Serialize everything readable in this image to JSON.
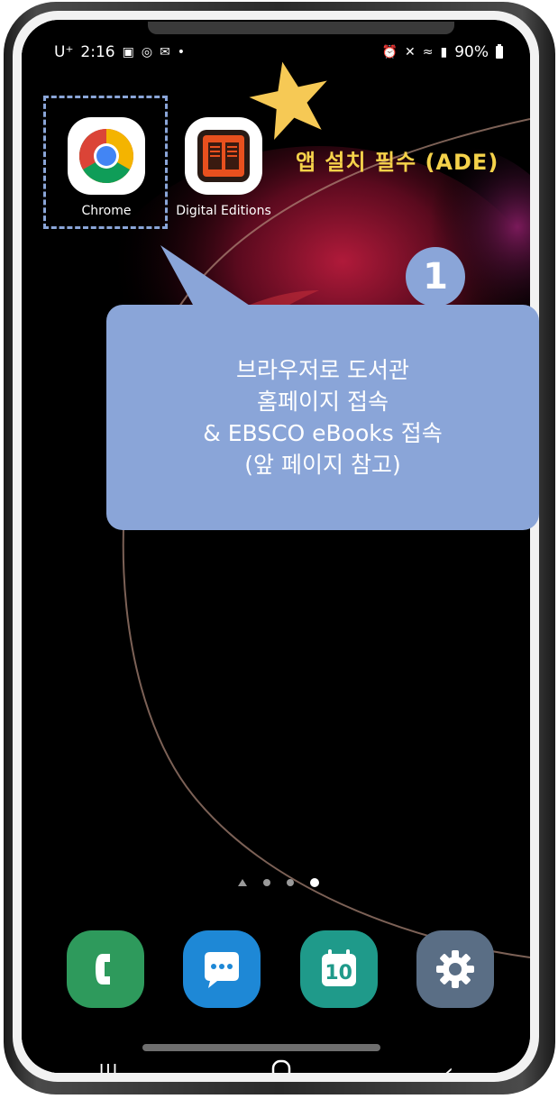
{
  "status_bar": {
    "carrier": "U⁺",
    "time": "2:16",
    "battery_percent": "90%"
  },
  "apps": [
    {
      "label": "Chrome",
      "icon": "chrome-icon"
    },
    {
      "label": "Digital Editions",
      "icon": "digital-editions-icon"
    }
  ],
  "annotation": {
    "ade_note": "앱 설치 필수 (ADE)",
    "step_number": "1",
    "callout_lines": [
      "브라우저로 도서관",
      "홈페이지 접속",
      "& EBSCO eBooks 접속",
      "(앞 페이지 참고)"
    ]
  },
  "dock": [
    {
      "icon": "phone-icon",
      "color": "#2e9a5c"
    },
    {
      "icon": "messages-icon",
      "color": "#1e88d6"
    },
    {
      "icon": "calendar-icon",
      "color": "#1f9a8a",
      "day": "10"
    },
    {
      "icon": "settings-icon",
      "color": "#5a6e85"
    }
  ],
  "colors": {
    "accent": "#8aa5d8",
    "note": "#f5d24a",
    "star": "#f6c955"
  }
}
